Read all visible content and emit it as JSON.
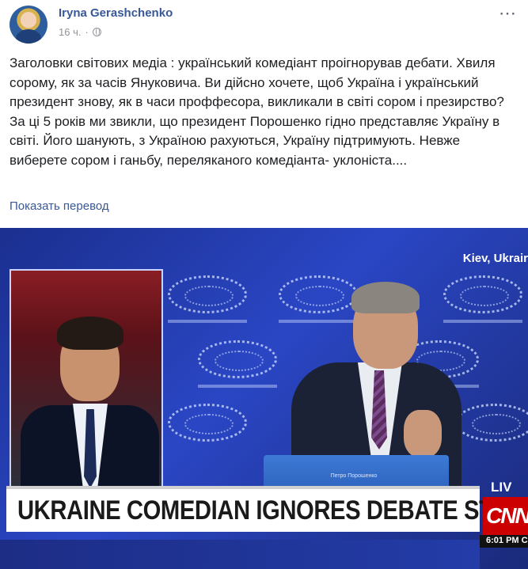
{
  "post": {
    "author": "Iryna Gerashchenko",
    "time": "16 ч.",
    "separator": "·",
    "more_icon": "⋯",
    "paragraphs": [
      "Заголовки світових медіа : український комедіант проігнорував дебати. Хвиля сорому, як за часів Януковича. Ви дійсно хочете, щоб Україна і український президент знову, як в часи проффесора, викликали в світі сором і презирство?",
      "За ці 5 років ми звикли, що президент Порошенко гідно представляє Україну в світі. Його шанують, з Україною рахуються, Україну підтримують. Невже виберете сором і ганьбу, переляканого комедіанта- уклоніста...."
    ],
    "translate_link": "Показать перевод"
  },
  "media": {
    "location": "Kiev, Ukrair",
    "headline": "UKRAINE COMEDIAN IGNORES DEBATE STAGE",
    "live": "LIV",
    "network": "CNN",
    "time": "6:01 PM C",
    "podium_label": "Петро Порошенко"
  },
  "icons": {
    "globe": "globe-icon",
    "more": "more-options-icon"
  },
  "colors": {
    "author": "#385898",
    "meta": "#90949c",
    "link": "#385898",
    "stage_blue": "#2a46c4",
    "cnn_red": "#cc0000"
  }
}
